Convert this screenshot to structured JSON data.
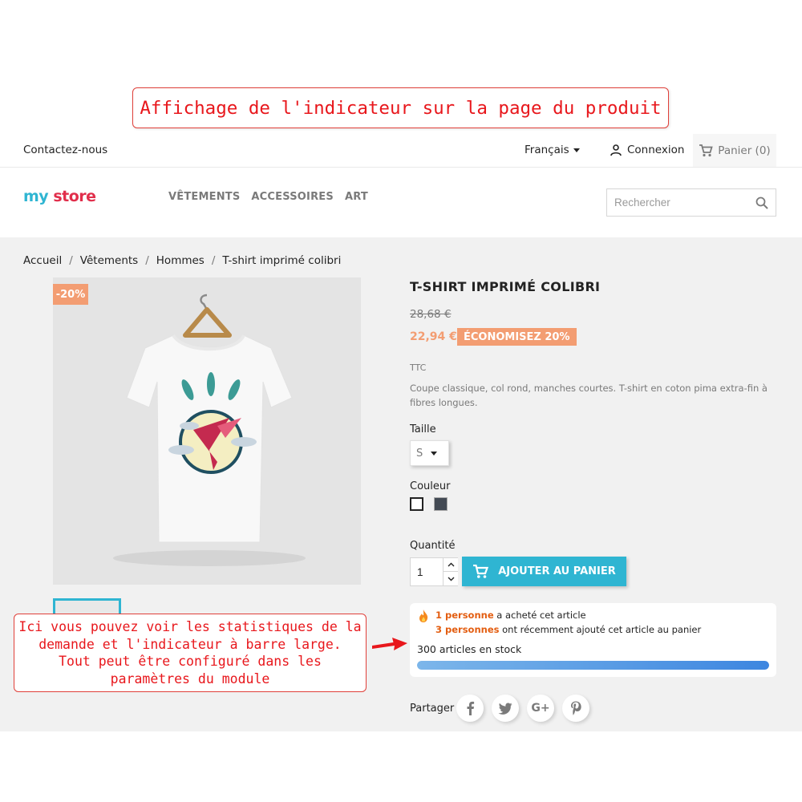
{
  "annotations": {
    "top_banner": "Affichage de l'indicateur sur la page du produit",
    "bottom_note": "Ici vous pouvez voir les statistiques de la\ndemande et l'indicateur à barre large.\nTout peut être configuré dans les\nparamètres du module"
  },
  "header": {
    "contact_label": "Contactez-nous",
    "language": "Français",
    "login_label": "Connexion",
    "cart_label": "Panier (0)"
  },
  "logo": {
    "part1": "my",
    "part2": "store"
  },
  "menu": [
    "VÊTEMENTS",
    "ACCESSOIRES",
    "ART"
  ],
  "search": {
    "placeholder": "Rechercher"
  },
  "breadcrumb": [
    "Accueil",
    "Vêtements",
    "Hommes",
    "T-shirt imprimé colibri"
  ],
  "product": {
    "discount_flag": "-20%",
    "title": "T-SHIRT IMPRIMÉ COLIBRI",
    "old_price": "28,68 €",
    "price": "22,94 €",
    "save_badge": "ÉCONOMISEZ 20%",
    "tax_label": "TTC",
    "description": "Coupe classique, col rond, manches courtes. T-shirt en coton pima extra-fin à fibres longues.",
    "size_label": "Taille",
    "size_value": "S",
    "color_label": "Couleur",
    "colors": [
      "#ffffff",
      "#434a54"
    ],
    "quantity_label": "Quantité",
    "quantity_value": "1",
    "add_to_cart_label": "AJOUTER AU PANIER"
  },
  "stats": {
    "bought_count": "1 personne",
    "bought_text": " a acheté cet article",
    "added_count": "3 personnes",
    "added_text": " ont récemment ajouté cet article au panier",
    "stock_text": "300 articles en stock",
    "stock_fill_fraction": 1.0
  },
  "share": {
    "label": "Partager",
    "networks": [
      "facebook-icon",
      "twitter-icon",
      "google-plus-icon",
      "pinterest-icon"
    ]
  },
  "colors": {
    "accent": "#2fb5d2",
    "discount": "#f39d72",
    "annotation": "#e8171c",
    "highlight": "#e35d10"
  }
}
